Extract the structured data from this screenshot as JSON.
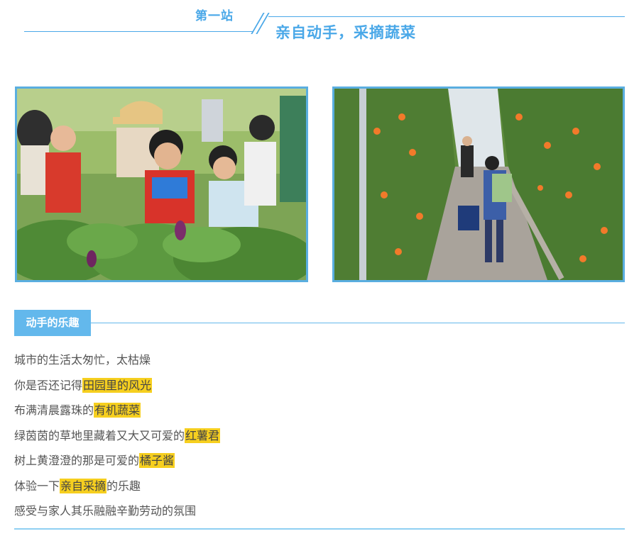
{
  "header": {
    "station_label": "第一站",
    "station_title": "亲自动手，采摘蔬菜"
  },
  "photos": {
    "left_alt_icon": "children-picking-vegetables-photo",
    "right_alt_icon": "greenhouse-walkway-photo"
  },
  "section": {
    "tag": "动手的乐趣"
  },
  "poem": {
    "l1": "城市的生活太匆忙，太枯燥",
    "l2a": "你是否还记得",
    "l2b": "田园里的风光",
    "l3a": "布满清晨露珠的",
    "l3b": "有机蔬菜",
    "l4a": "绿茵茵的草地里藏着又大又可爱的",
    "l4b": "红薯君",
    "l5a": "树上黄澄澄的那是可爱的",
    "l5b": "橘子酱",
    "l6a": "体验一下",
    "l6b": "亲自采摘",
    "l6c": "的乐趣",
    "l7": "感受与家人其乐融融辛勤劳动的氛围"
  },
  "colors": {
    "accent": "#4aa8e8",
    "highlight": "#f6cf1f"
  }
}
